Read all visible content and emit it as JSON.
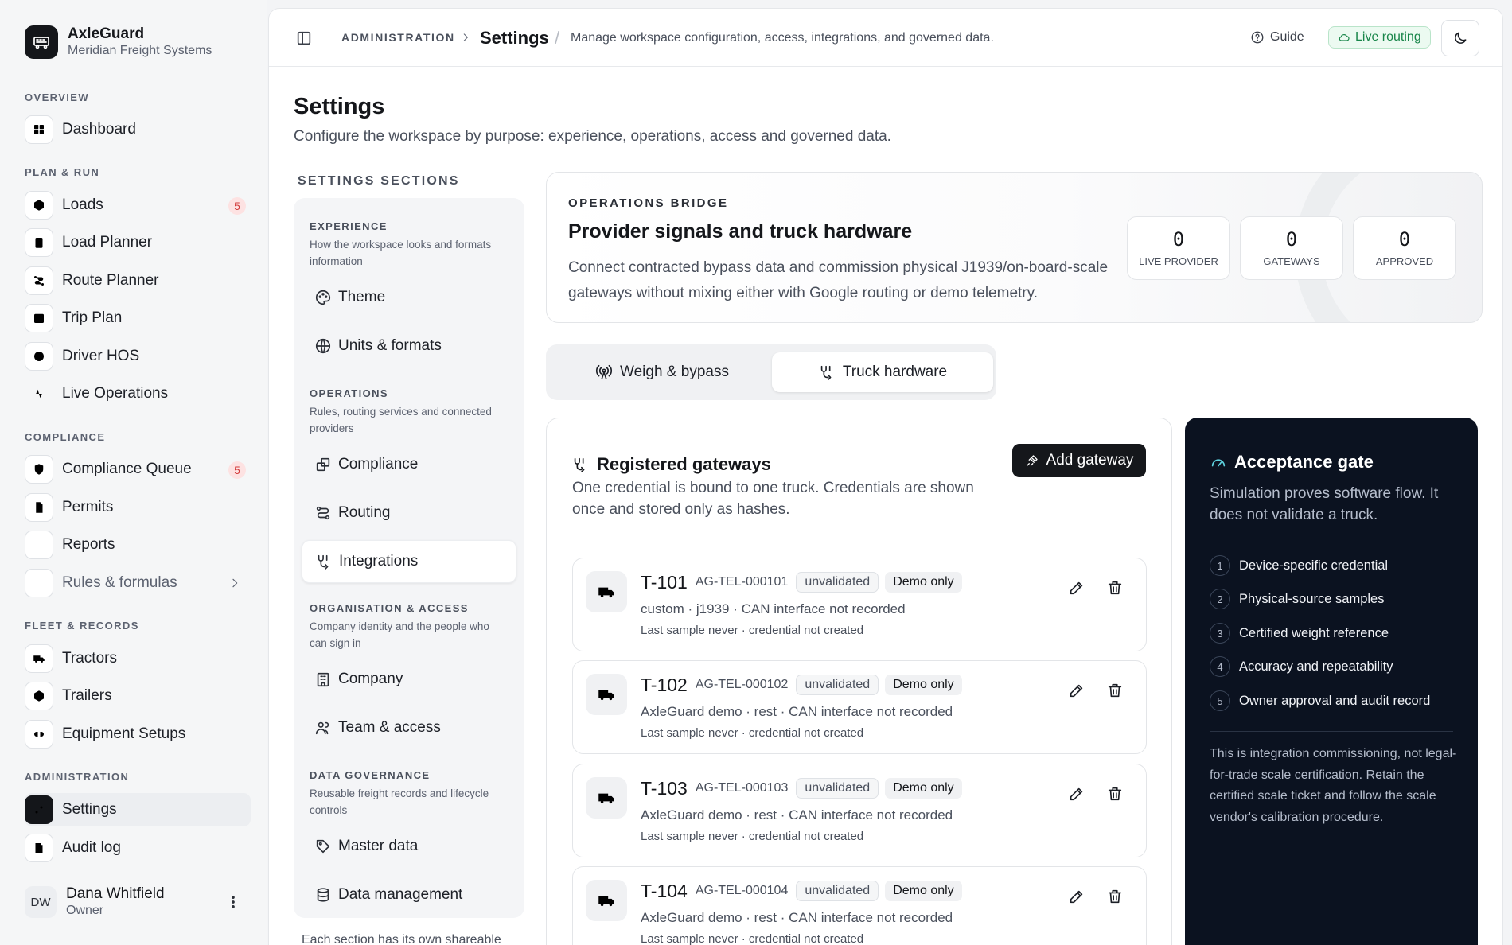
{
  "brand": {
    "name": "AxleGuard",
    "org": "Meridian Freight Systems"
  },
  "nav": {
    "groups": [
      "OVERVIEW",
      "PLAN & RUN",
      "COMPLIANCE",
      "FLEET & RECORDS",
      "ADMINISTRATION"
    ],
    "items": [
      {
        "label": "Dashboard",
        "icon": "dashboard-icon"
      },
      {
        "label": "Loads",
        "icon": "box-icon",
        "badge": "5"
      },
      {
        "label": "Load Planner",
        "icon": "clipboard-icon"
      },
      {
        "label": "Route Planner",
        "icon": "route-icon"
      },
      {
        "label": "Trip Plan",
        "icon": "calendar-icon"
      },
      {
        "label": "Driver HOS",
        "icon": "clock-icon"
      },
      {
        "label": "Live Operations",
        "icon": "activity-icon"
      },
      {
        "label": "Compliance Queue",
        "icon": "shield-icon",
        "badge": "5"
      },
      {
        "label": "Permits",
        "icon": "document-icon"
      },
      {
        "label": "Reports",
        "icon": "chart-icon"
      },
      {
        "label": "Rules & formulas",
        "icon": "library-icon"
      },
      {
        "label": "Tractors",
        "icon": "truck-icon"
      },
      {
        "label": "Trailers",
        "icon": "trailer-icon"
      },
      {
        "label": "Equipment Setups",
        "icon": "link-icon"
      },
      {
        "label": "Settings",
        "icon": "sliders-icon"
      },
      {
        "label": "Audit log",
        "icon": "log-icon"
      }
    ]
  },
  "user": {
    "initials": "DW",
    "name": "Dana Whitfield",
    "role": "Owner"
  },
  "topbar": {
    "crumb": "ADMINISTRATION",
    "title": "Settings",
    "slash": "/",
    "desc": "Manage workspace configuration, access, integrations, and governed data.",
    "guide": "Guide",
    "live": "Live routing"
  },
  "page": {
    "title": "Settings",
    "subtitle": "Configure the workspace by purpose: experience, operations, access and governed data."
  },
  "sections": {
    "heading": "SETTINGS SECTIONS",
    "groups": [
      {
        "title": "EXPERIENCE",
        "desc": "How the workspace looks and formats information"
      },
      {
        "title": "OPERATIONS",
        "desc": "Rules, routing services and connected providers"
      },
      {
        "title": "ORGANISATION & ACCESS",
        "desc": "Company identity and the people who can sign in"
      },
      {
        "title": "DATA GOVERNANCE",
        "desc": "Reusable freight records and lifecycle controls"
      }
    ],
    "items": [
      {
        "label": "Theme",
        "icon": "palette-icon"
      },
      {
        "label": "Units & formats",
        "icon": "globe-icon"
      },
      {
        "label": "Compliance",
        "icon": "compliance-icon"
      },
      {
        "label": "Routing",
        "icon": "route-icon"
      },
      {
        "label": "Integrations",
        "icon": "integrations-icon"
      },
      {
        "label": "Company",
        "icon": "building-icon"
      },
      {
        "label": "Team & access",
        "icon": "team-icon"
      },
      {
        "label": "Master data",
        "icon": "tag-icon"
      },
      {
        "label": "Data management",
        "icon": "database-icon"
      }
    ],
    "footer": "Each section has its own shareable"
  },
  "bridge": {
    "eyebrow": "OPERATIONS BRIDGE",
    "title": "Provider signals and truck hardware",
    "desc": "Connect contracted bypass data and commission physical J1939/on-board-scale gateways without mixing either with Google routing or demo telemetry.",
    "stats": [
      {
        "value": "0",
        "label": "LIVE PROVIDER"
      },
      {
        "value": "0",
        "label": "GATEWAYS"
      },
      {
        "value": "0",
        "label": "APPROVED"
      }
    ]
  },
  "tabs": [
    {
      "label": "Weigh & bypass",
      "icon": "broadcast-icon"
    },
    {
      "label": "Truck hardware",
      "icon": "integrations-icon"
    }
  ],
  "gateways": {
    "title": "Registered gateways",
    "desc": "One credential is bound to one truck. Credentials are shown once and stored only as hashes.",
    "add_label": "Add gateway",
    "rows": [
      {
        "unit": "T-101",
        "code": "AG-TEL-000101",
        "status": "unvalidated",
        "tag": "Demo only",
        "meta": "custom · j1939 · CAN interface not recorded",
        "last": "Last sample never · credential not created"
      },
      {
        "unit": "T-102",
        "code": "AG-TEL-000102",
        "status": "unvalidated",
        "tag": "Demo only",
        "meta": "AxleGuard demo · rest · CAN interface not recorded",
        "last": "Last sample never · credential not created"
      },
      {
        "unit": "T-103",
        "code": "AG-TEL-000103",
        "status": "unvalidated",
        "tag": "Demo only",
        "meta": "AxleGuard demo · rest · CAN interface not recorded",
        "last": "Last sample never · credential not created"
      },
      {
        "unit": "T-104",
        "code": "AG-TEL-000104",
        "status": "unvalidated",
        "tag": "Demo only",
        "meta": "AxleGuard demo · rest · CAN interface not recorded",
        "last": "Last sample never · credential not created"
      }
    ]
  },
  "gate": {
    "title": "Acceptance gate",
    "desc": "Simulation proves software flow. It does not validate a truck.",
    "steps": [
      {
        "n": "1",
        "label": "Device-specific credential"
      },
      {
        "n": "2",
        "label": "Physical-source samples"
      },
      {
        "n": "3",
        "label": "Certified weight reference"
      },
      {
        "n": "4",
        "label": "Accuracy and repeatability"
      },
      {
        "n": "5",
        "label": "Owner approval and audit record"
      }
    ],
    "note": "This is integration commissioning, not legal-for-trade scale certification. Retain the certified scale ticket and follow the scale vendor's calibration procedure."
  },
  "colors": {
    "accent": "#15171b",
    "live": "#19864a",
    "badge": "#d23a3a",
    "gate_bg": "#0b1220"
  }
}
